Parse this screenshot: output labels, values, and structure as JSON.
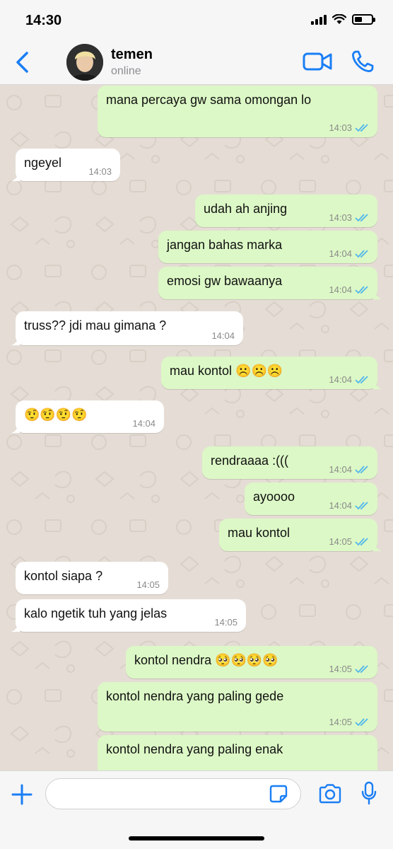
{
  "status_bar": {
    "time": "14:30"
  },
  "header": {
    "contact_name": "temen",
    "contact_status": "online"
  },
  "messages": [
    {
      "dir": "out",
      "text": "mana percaya gw sama omongan lo",
      "time": "14:03"
    },
    {
      "dir": "in",
      "text": "ngeyel",
      "time": "14:03"
    },
    {
      "dir": "out",
      "text": "udah ah anjing",
      "time": "14:03"
    },
    {
      "dir": "out",
      "text": "jangan bahas marka",
      "time": "14:04"
    },
    {
      "dir": "out",
      "text": "emosi gw bawaanya",
      "time": "14:04"
    },
    {
      "dir": "in",
      "text": "truss?? jdi mau gimana ?",
      "time": "14:04"
    },
    {
      "dir": "out",
      "text": "mau kontol ☹️☹️☹️",
      "time": "14:04"
    },
    {
      "dir": "in",
      "text": "🤨🤨🤨🤨",
      "time": "14:04"
    },
    {
      "dir": "out",
      "text": "rendraaaa :(((",
      "time": "14:04"
    },
    {
      "dir": "out",
      "text": "ayoooo",
      "time": "14:04"
    },
    {
      "dir": "out",
      "text": "mau kontol",
      "time": "14:05"
    },
    {
      "dir": "in",
      "text": "kontol siapa ?",
      "time": "14:05"
    },
    {
      "dir": "in",
      "text": "kalo ngetik tuh yang jelas",
      "time": "14:05"
    },
    {
      "dir": "out",
      "text": "kontol nendra 🥺🥺🥺🥺",
      "time": "14:05"
    },
    {
      "dir": "out",
      "text": "kontol nendra yang paling gede",
      "time": "14:05"
    },
    {
      "dir": "out",
      "text": "kontol nendra yang paling enak",
      "time": ""
    }
  ],
  "input": {
    "placeholder": ""
  },
  "colors": {
    "accent": "#1a7ef5",
    "outgoing": "#dcf8c6",
    "incoming": "#ffffff",
    "read_ticks": "#4fb6ec",
    "background": "#e5ddd5"
  }
}
